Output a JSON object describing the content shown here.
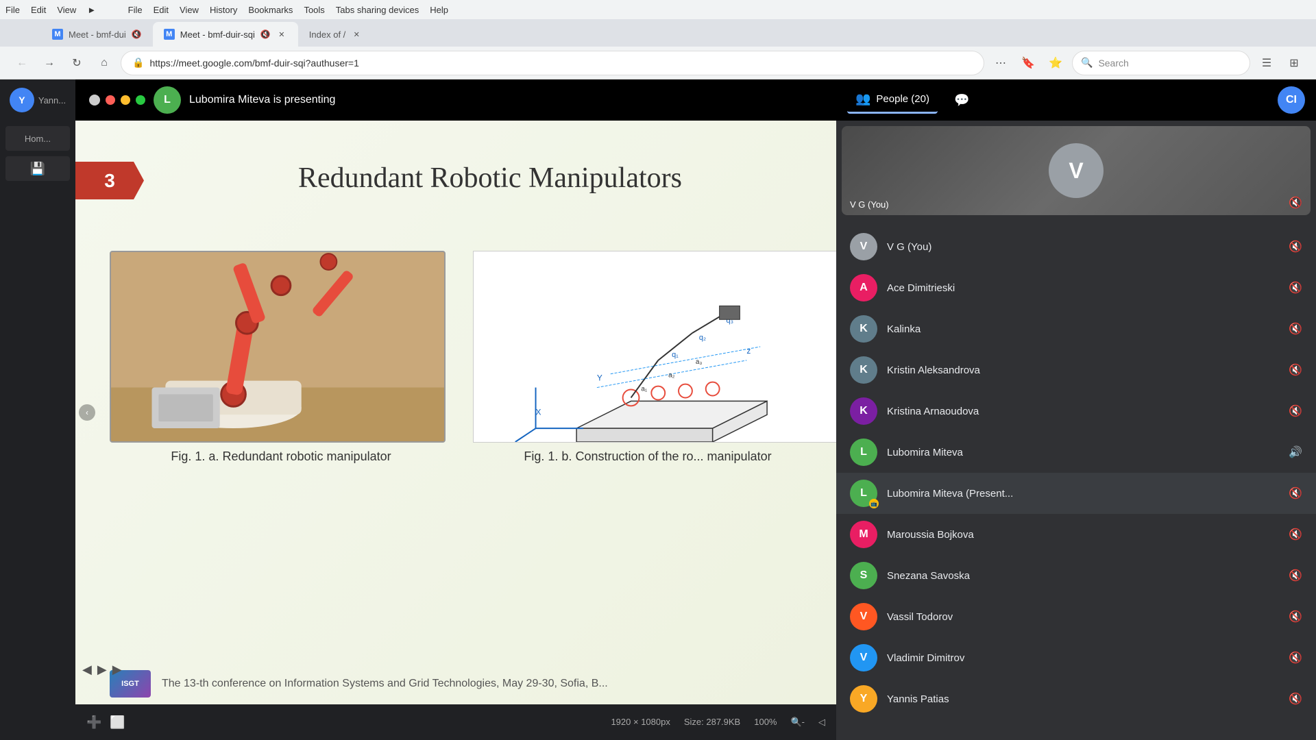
{
  "browser": {
    "tabs": [
      {
        "id": "meet1",
        "title": "Meet - bmf-dui",
        "favicon": "M",
        "active": false,
        "muted": true
      },
      {
        "id": "meet2",
        "title": "Meet - bmf-duir-sqi",
        "favicon": "M",
        "active": true,
        "muted": true
      },
      {
        "id": "index",
        "title": "Index of /",
        "favicon": "I",
        "active": false
      }
    ],
    "address": "https://meet.google.com/bmf-duir-sqi?authuser=1",
    "search_placeholder": "Search",
    "zoom": "100%"
  },
  "meet": {
    "presenter_label": "Lubomira Miteva is presenting",
    "presenter_initial": "L",
    "people_count": "People (20)",
    "ci_label": "CI"
  },
  "slide": {
    "number": "3",
    "title": "Redundant Robotic Manipulators",
    "fig_left_caption": "Fig. 1. a. Redundant robotic manipulator",
    "fig_right_caption": "Fig. 1. b. Construction of the ro... manipulator",
    "footer_logo": "ISGT",
    "footer_text": "The 13-th conference on Information Systems and Grid Technologies, May 29-30, Sofia, B..."
  },
  "people": [
    {
      "name": "V G (You)",
      "initial": "V",
      "color": "#9aa0a6",
      "muted": true
    },
    {
      "name": "Ace Dimitrieski",
      "initial": "A",
      "color": "#e91e63",
      "muted": true
    },
    {
      "name": "Kalinka",
      "initial": "K",
      "color": "#607d8b",
      "muted": true
    },
    {
      "name": "Kristin Aleksandrova",
      "initial": "K",
      "color": "#607d8b",
      "muted": true
    },
    {
      "name": "Kristina Arnaoudova",
      "initial": "K",
      "color": "#7b1fa2",
      "muted": true
    },
    {
      "name": "Lubomira Miteva",
      "initial": "L",
      "color": "#4caf50",
      "speaking": true
    },
    {
      "name": "Lubomira Miteva (Present...",
      "initial": "L",
      "color": "#4caf50",
      "presenting": true,
      "muted": true
    },
    {
      "name": "Maroussia Bojkova",
      "initial": "M",
      "color": "#e91e63",
      "muted": true
    },
    {
      "name": "Snezana Savoska",
      "initial": "S",
      "color": "#4caf50",
      "muted": true
    },
    {
      "name": "Vassil Todorov",
      "initial": "V",
      "color": "#ff5722",
      "muted": true
    },
    {
      "name": "Vladimir Dimitrov",
      "initial": "V",
      "color": "#2196f3",
      "muted": true
    },
    {
      "name": "Yannis Patias",
      "initial": "Y",
      "color": "#f9a825",
      "muted": true
    }
  ],
  "statusbar": {
    "dimensions": "1920 × 1080px",
    "size": "Size: 287.9KB",
    "zoom_percent": "100%"
  },
  "menu": {
    "items1": [
      "File",
      "Edit",
      "View",
      "►"
    ],
    "items2": [
      "File",
      "Edit",
      "View",
      "History",
      "Bookmarks",
      "Tools",
      "Tabs sharing devices",
      "Help"
    ]
  }
}
